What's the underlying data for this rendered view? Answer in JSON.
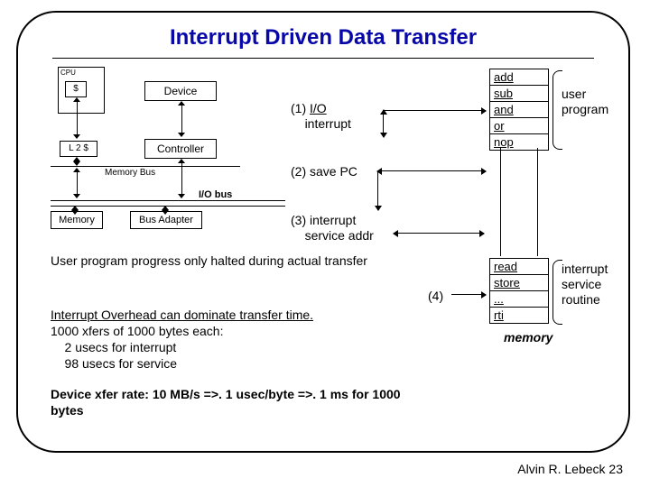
{
  "title": "Interrupt Driven Data Transfer",
  "blocks": {
    "cpu": "CPU",
    "cache": "$",
    "device": "Device",
    "l2": "L 2 $",
    "controller": "Controller",
    "memory": "Memory",
    "bus_adapter": "Bus Adapter"
  },
  "bus_labels": {
    "memory_bus": "Memory Bus",
    "io_bus": "I/O bus"
  },
  "steps": {
    "s1_a": "(1) ",
    "s1_b": "I/O",
    "s1_c": "interrupt",
    "s2": "(2) save PC",
    "s3_a": "(3) interrupt",
    "s3_b": "service addr",
    "s4": "(4)"
  },
  "memory_rows_user": [
    "add",
    "sub",
    "and",
    "or",
    "nop"
  ],
  "memory_rows_isr": [
    "read",
    "store",
    "...",
    "rti"
  ],
  "side_labels": {
    "user": "user\nprogram",
    "isr": "interrupt\nservice\nroutine",
    "memory": "memory"
  },
  "paragraphs": {
    "p1": "User program progress only halted during actual transfer",
    "p2_l1": "Interrupt Overhead can dominate transfer time.",
    "p2_l2": "1000 xfers of 1000 bytes each:",
    "p2_l3": "    2 usecs for interrupt",
    "p2_l4": "    98 usecs for service",
    "p3": "Device xfer rate: 10 MB/s =>. 1 usec/byte =>. 1 ms for 1000 bytes"
  },
  "footer": "Alvin R. Lebeck 23"
}
